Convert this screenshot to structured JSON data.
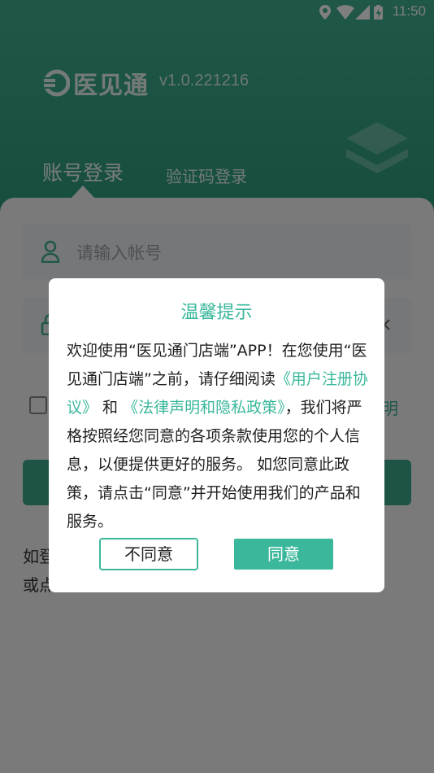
{
  "status_bar": {
    "time": "11:50"
  },
  "header": {
    "app_name": "医见通",
    "version": "v1.0.221216",
    "tabs": [
      {
        "label": "账号登录",
        "active": true
      },
      {
        "label": "验证码登录",
        "active": false
      }
    ]
  },
  "form": {
    "account_placeholder": "请输入帐号",
    "agreement_tail": "明"
  },
  "footer": {
    "line1": "如登",
    "line2": "或点"
  },
  "dialog": {
    "title": "温馨提示",
    "body_1": "欢迎使用“医见通门店端”APP！在您使用“医见通门店端”之前，请仔细阅读",
    "link_1": "《用户注册协议》",
    "body_2": " 和 ",
    "link_2": "《法律声明和隐私政策》",
    "body_3": "，我们将严格按照经您同意的各项条款使用您的个人信息，以便提供更好的服务。 如您同意此政策，请点击“同意”并开始使用我们的产品和服务。",
    "disagree_label": "不同意",
    "agree_label": "同意"
  },
  "colors": {
    "brand": "#3fae90",
    "accent": "#3bb89c"
  }
}
